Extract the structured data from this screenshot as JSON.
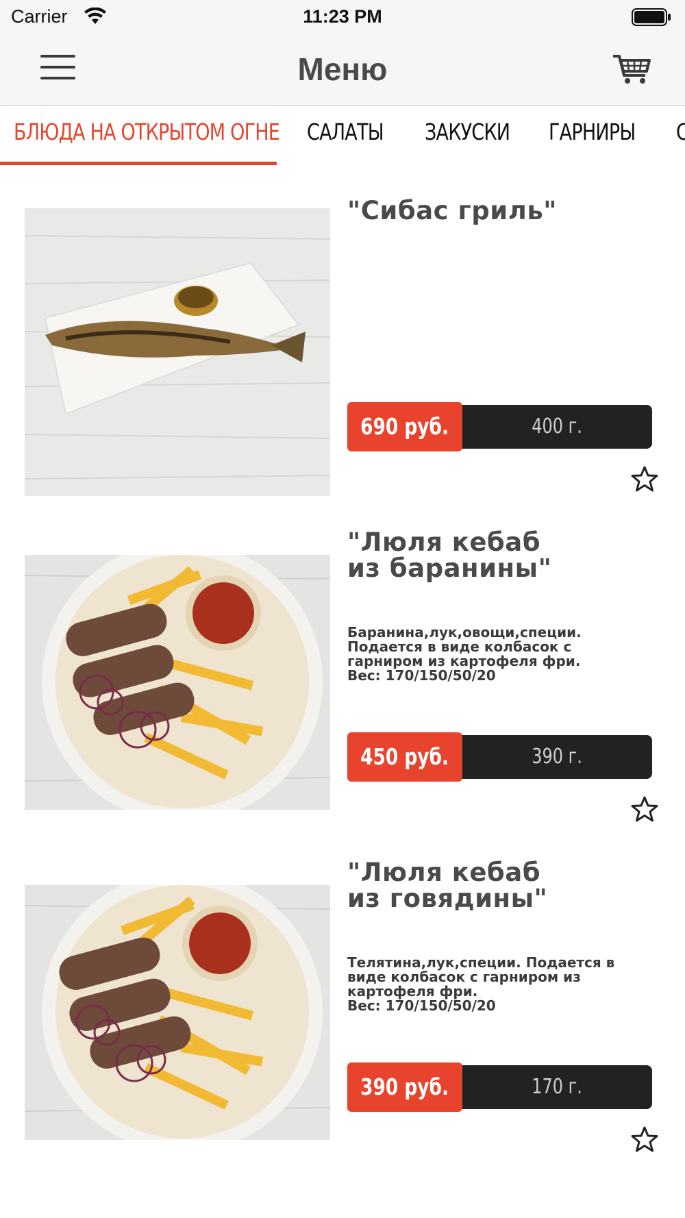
{
  "status_bar": {
    "carrier": "Carrier",
    "time": "11:23 PM"
  },
  "header": {
    "title": "Меню"
  },
  "tabs": [
    {
      "label": "БЛЮДА НА ОТКРЫТОМ ОГНЕ",
      "active": true
    },
    {
      "label": "САЛАТЫ",
      "active": false
    },
    {
      "label": "ЗАКУСКИ",
      "active": false
    },
    {
      "label": "ГАРНИРЫ",
      "active": false
    },
    {
      "label": "С",
      "active": false
    }
  ],
  "items": [
    {
      "title": "\"Сибас гриль\"",
      "description": "",
      "price": "690 руб.",
      "weight": "400 г."
    },
    {
      "title": "\"Люля кебаб\nиз баранины\"",
      "description": "Баранина,лук,овощи,специи.\nПодается в виде колбасок с\nгарниром из картофеля фри.\nВес: 170/150/50/20",
      "price": "450 руб.",
      "weight": "390 г."
    },
    {
      "title": "\"Люля кебаб\nиз говядины\"",
      "description": "Телятина,лук,специи. Подается в\nвиде колбасок с гарниром из\nкартофеля фри.\nВес: 170/150/50/20",
      "price": "390 руб.",
      "weight": "170 г."
    }
  ],
  "colors": {
    "accent": "#e8432c",
    "price_bar": "#222222",
    "nav_bg": "#f6f6f6"
  }
}
